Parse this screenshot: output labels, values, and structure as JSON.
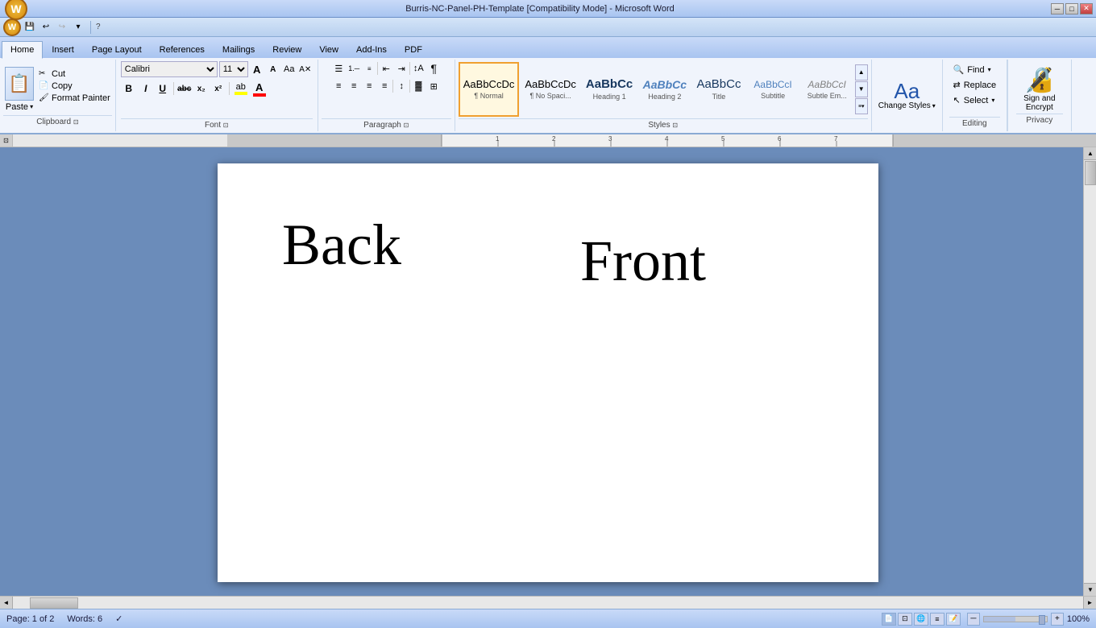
{
  "titlebar": {
    "title": "Burris-NC-Panel-PH-Template [Compatibility Mode] - Microsoft Word",
    "minimize": "─",
    "maximize": "□",
    "close": "✕"
  },
  "quickaccess": {
    "save": "💾",
    "undo": "↩",
    "redo": "↪",
    "customize": "▾"
  },
  "tabs": [
    {
      "label": "Home",
      "active": true
    },
    {
      "label": "Insert",
      "active": false
    },
    {
      "label": "Page Layout",
      "active": false
    },
    {
      "label": "References",
      "active": false
    },
    {
      "label": "Mailings",
      "active": false
    },
    {
      "label": "Review",
      "active": false
    },
    {
      "label": "View",
      "active": false
    },
    {
      "label": "Add-Ins",
      "active": false
    },
    {
      "label": "PDF",
      "active": false
    }
  ],
  "clipboard": {
    "paste_label": "Paste",
    "cut_label": "Cut",
    "copy_label": "Copy",
    "format_painter_label": "Format Painter",
    "group_label": "Clipboard"
  },
  "font": {
    "font_name": "Calibri",
    "font_size": "11",
    "bold": "B",
    "italic": "I",
    "underline": "U",
    "strikethrough": "abc",
    "subscript": "x₂",
    "superscript": "x²",
    "grow": "A",
    "shrink": "A",
    "change_case": "Aa",
    "clear_format": "A",
    "highlight_color": "ab",
    "font_color": "A",
    "group_label": "Font"
  },
  "paragraph": {
    "bullets": "☰",
    "numbering": "☰",
    "multilevel": "☰",
    "decrease_indent": "⇤",
    "increase_indent": "⇥",
    "sort": "↕",
    "show_marks": "¶",
    "align_left": "≡",
    "align_center": "≡",
    "align_right": "≡",
    "justify": "≡",
    "line_spacing": "↕",
    "shading": "▓",
    "borders": "⊞",
    "group_label": "Paragraph"
  },
  "styles": [
    {
      "label": "¶ Normal",
      "name": "Normal",
      "active": true,
      "preview_style": "normal"
    },
    {
      "label": "¶ No Spaci...",
      "name": "No Spacing",
      "active": false,
      "preview_style": "normal"
    },
    {
      "label": "AaBbCc",
      "name": "Heading 1",
      "active": false,
      "preview_style": "heading1"
    },
    {
      "label": "AaBbCc",
      "name": "Heading 2",
      "active": false,
      "preview_style": "heading2"
    },
    {
      "label": "AaBbCc",
      "name": "Title",
      "active": false,
      "preview_style": "title"
    },
    {
      "label": "AaBbCcI",
      "name": "Subtitle",
      "active": false,
      "preview_style": "subtitle"
    },
    {
      "label": "AaBbCcI",
      "name": "Subtle Em...",
      "active": false,
      "preview_style": "subtle"
    }
  ],
  "change_styles": {
    "label": "Change\nStyles",
    "arrow": "▾"
  },
  "editing": {
    "find_label": "Find",
    "replace_label": "Replace",
    "select_label": "Select",
    "group_label": "Editing",
    "find_arrow": "▾",
    "select_arrow": "▾"
  },
  "sign_encrypt": {
    "label": "Sign and\nEncrypt",
    "privacy_label": "Privacy"
  },
  "document": {
    "back_text": "Back",
    "front_text": "Front"
  },
  "statusbar": {
    "page_info": "Page: 1 of 2",
    "words": "Words: 6",
    "language_icon": "✓",
    "zoom_level": "100%",
    "zoom_minus": "─",
    "zoom_plus": "+"
  }
}
